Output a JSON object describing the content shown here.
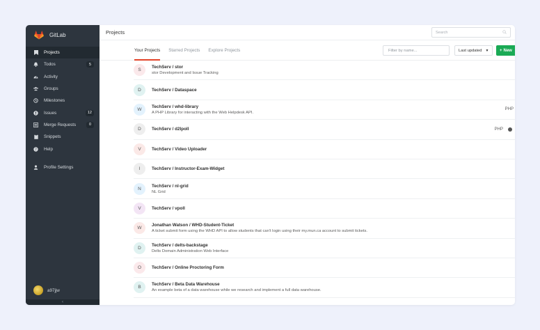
{
  "app": {
    "name": "GitLab"
  },
  "sidebar": {
    "items": [
      {
        "label": "Projects",
        "icon": "bookmark-icon",
        "badge": "",
        "active": true
      },
      {
        "label": "Todos",
        "icon": "bell-icon",
        "badge": "5",
        "active": false
      },
      {
        "label": "Activity",
        "icon": "dashboard-icon",
        "badge": "",
        "active": false
      },
      {
        "label": "Groups",
        "icon": "group-icon",
        "badge": "",
        "active": false
      },
      {
        "label": "Milestones",
        "icon": "clock-icon",
        "badge": "",
        "active": false
      },
      {
        "label": "Issues",
        "icon": "exclamation-icon",
        "badge": "12",
        "active": false
      },
      {
        "label": "Merge Requests",
        "icon": "list-icon",
        "badge": "0",
        "active": false
      },
      {
        "label": "Snippets",
        "icon": "clipboard-icon",
        "badge": "",
        "active": false
      },
      {
        "label": "Help",
        "icon": "question-icon",
        "badge": "",
        "active": false
      }
    ],
    "profile_settings": "Profile Settings",
    "username": "a97jjw",
    "collapse_icon": "chevron-left-icon"
  },
  "header": {
    "title": "Projects",
    "search_placeholder": "Search"
  },
  "toolbar": {
    "tabs": [
      "Your Projects",
      "Starred Projects",
      "Explore Projects"
    ],
    "filter_placeholder": "Filter by name...",
    "sort_label": "Last updated",
    "new_label": "New"
  },
  "projects": [
    {
      "initial": "S",
      "name": "TechServ / stor",
      "description": "stor Development and Issue Tracking",
      "language": "",
      "avatar_color": "#fbe9eb"
    },
    {
      "initial": "D",
      "name": "TechServ / Dataspace",
      "description": "",
      "language": "",
      "avatar_color": "#e0f2f1"
    },
    {
      "initial": "W",
      "name": "TechServ / whd-library",
      "description": "A PHP Library for interacting with the Web Helpdesk API.",
      "language": "PHP",
      "avatar_color": "#e3f2fd"
    },
    {
      "initial": "D",
      "name": "TechServ / d2lpoll",
      "description": "",
      "language": "PHP",
      "avatar_color": "#eeeeee"
    },
    {
      "initial": "V",
      "name": "TechServ / Video Uploader",
      "description": "",
      "language": "",
      "avatar_color": "#fbe9e7"
    },
    {
      "initial": "I",
      "name": "TechServ / Instructor-Exam-Widget",
      "description": "",
      "language": "",
      "avatar_color": "#eeeeee"
    },
    {
      "initial": "N",
      "name": "TechServ / nl-grid",
      "description": "NL Grid",
      "language": "",
      "avatar_color": "#e3f2fd"
    },
    {
      "initial": "V",
      "name": "TechServ / vpoll",
      "description": "",
      "language": "",
      "avatar_color": "#f3e5f5"
    },
    {
      "initial": "W",
      "name": "Jonathan Watson / WHD-Student-Ticket",
      "description": "A ticket submit form using the WHD API to allow students that can't login using their my.mun.ca account to submit tickets.",
      "language": "",
      "avatar_color": "#fbe9e7"
    },
    {
      "initial": "D",
      "name": "TechServ / delts-backstage",
      "description": "Delts Domain Administration Web Interface",
      "language": "",
      "avatar_color": "#e0f2f1"
    },
    {
      "initial": "O",
      "name": "TechServ / Online Proctoring Form",
      "description": "",
      "language": "",
      "avatar_color": "#fbe9eb"
    },
    {
      "initial": "B",
      "name": "TechServ / Beta Data Warehouse",
      "description": "An example beta of a data warehouse while we research and implement a full data warehouse.",
      "language": "",
      "avatar_color": "#e0f2f1"
    }
  ],
  "colors": {
    "sidebar_bg": "#2d353e",
    "accent": "#e24329",
    "new_button": "#1aaa55"
  }
}
